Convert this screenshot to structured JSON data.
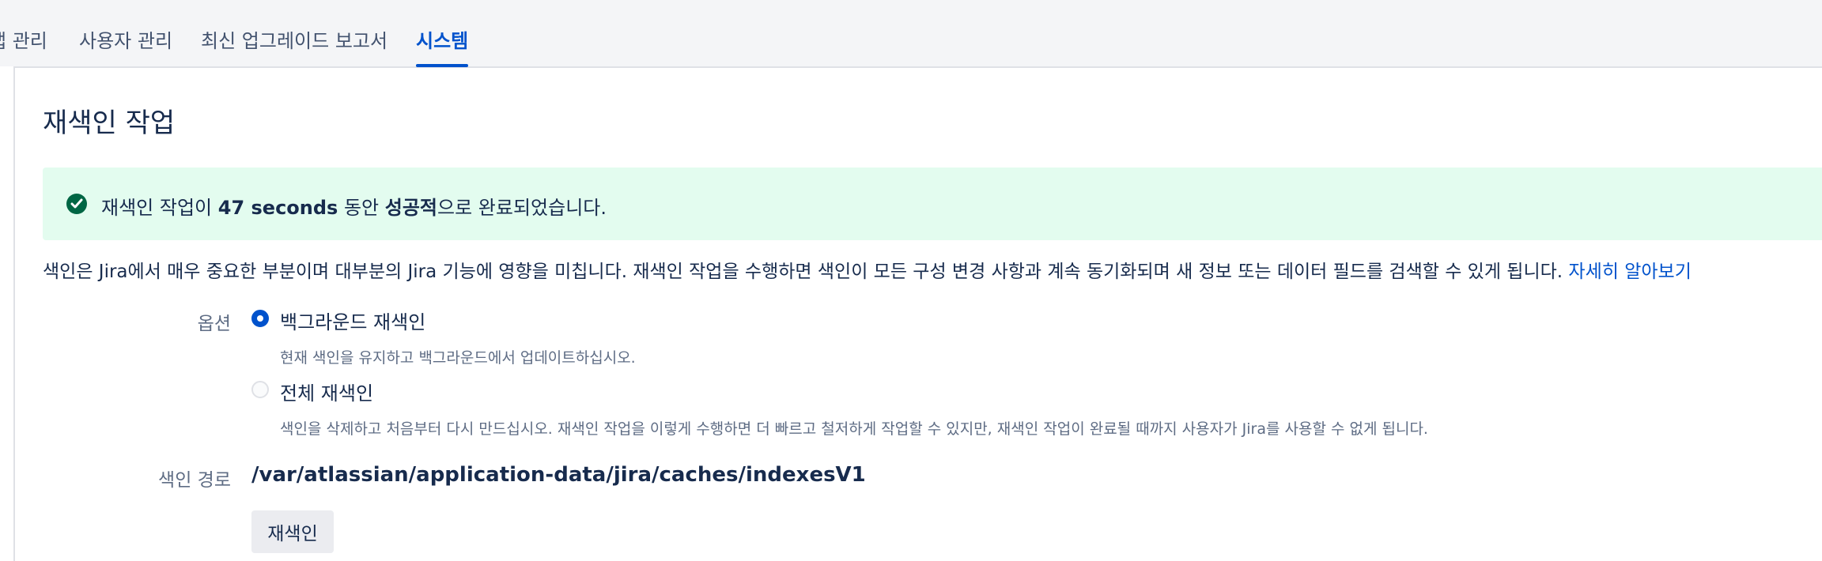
{
  "nav": {
    "tabs": [
      {
        "label": "앱 관리"
      },
      {
        "label": "사용자 관리"
      },
      {
        "label": "최신 업그레이드 보고서"
      },
      {
        "label": "시스템"
      }
    ]
  },
  "page": {
    "title": "재색인 작업"
  },
  "banner": {
    "pre": "재색인 작업이 ",
    "duration": "47 seconds",
    "mid": " 동안 ",
    "status": "성공적",
    "post": "으로 완료되었습니다."
  },
  "description": {
    "text": "색인은 Jira에서 매우 중요한 부분이며 대부분의 Jira 기능에 영향을 미칩니다. 재색인 작업을 수행하면 색인이 모든 구성 변경 사항과 계속 동기화되며 새 정보 또는 데이터 필드를 검색할 수 있게 됩니다. ",
    "link": "자세히 알아보기"
  },
  "options": {
    "label": "옵션",
    "items": [
      {
        "label": "백그라운드 재색인",
        "help": "현재 색인을 유지하고 백그라운드에서 업데이트하십시오.",
        "checked": true
      },
      {
        "label": "전체 재색인",
        "help": "색인을 삭제하고 처음부터 다시 만드십시오. 재색인 작업을 이렇게 수행하면 더 빠르고 철저하게 작업할 수 있지만, 재색인 작업이 완료될 때까지 사용자가 Jira를 사용할 수 없게 됩니다.",
        "checked": false
      }
    ]
  },
  "index_path": {
    "label": "색인 경로",
    "value": "/var/atlassian/application-data/jira/caches/indexesV1"
  },
  "actions": {
    "reindex": "재색인"
  },
  "colors": {
    "accent": "#0052cc",
    "success_bg": "#e3fcef",
    "success_icon": "#006644"
  }
}
